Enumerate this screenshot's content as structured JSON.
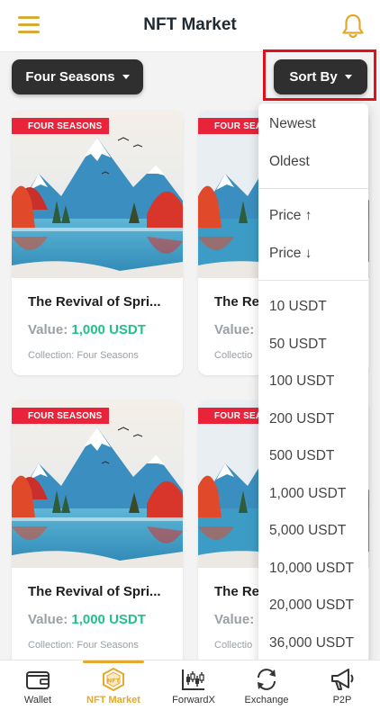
{
  "header": {
    "title": "NFT Market"
  },
  "filters": {
    "collection_label": "Four Seasons",
    "sort_label": "Sort By"
  },
  "cards": [
    {
      "tag": "FOUR SEASONS",
      "name": "The Revival of Spri...",
      "value_label": "Value:",
      "value_amount": "1,000 USDT",
      "collection": "Collection: Four Seasons"
    },
    {
      "tag": "FOUR SEAS",
      "name": "The Re",
      "value_label": "Value:",
      "value_amount": "",
      "collection": "Collectio"
    },
    {
      "tag": "FOUR SEASONS",
      "name": "The Revival of Spri...",
      "value_label": "Value:",
      "value_amount": "1,000 USDT",
      "collection": "Collection: Four Seasons"
    },
    {
      "tag": "FOUR SEAS",
      "name": "The Re",
      "value_label": "Value:",
      "value_amount": "",
      "collection": "Collectio"
    }
  ],
  "sort_menu": {
    "order_options": [
      "Newest",
      "Oldest"
    ],
    "price_options": [
      "Price ↑",
      "Price ↓"
    ],
    "amount_options": [
      "10 USDT",
      "50 USDT",
      "100 USDT",
      "200 USDT",
      "500 USDT",
      "1,000 USDT",
      "5,000 USDT",
      "10,000 USDT",
      "20,000 USDT",
      "36,000 USDT"
    ]
  },
  "bottom_nav": [
    {
      "label": "Wallet",
      "icon": "wallet-icon",
      "active": false
    },
    {
      "label": "NFT Market",
      "icon": "nft-icon",
      "active": true
    },
    {
      "label": "ForwardX",
      "icon": "candlestick-icon",
      "active": false
    },
    {
      "label": "Exchange",
      "icon": "exchange-icon",
      "active": false
    },
    {
      "label": "P2P",
      "icon": "megaphone-icon",
      "active": false
    }
  ],
  "colors": {
    "accent": "#e3a92c",
    "value_green": "#21c187",
    "tag_red": "#e8233a",
    "highlight_red": "#e0111b",
    "button_dark": "#2f2f2f"
  }
}
